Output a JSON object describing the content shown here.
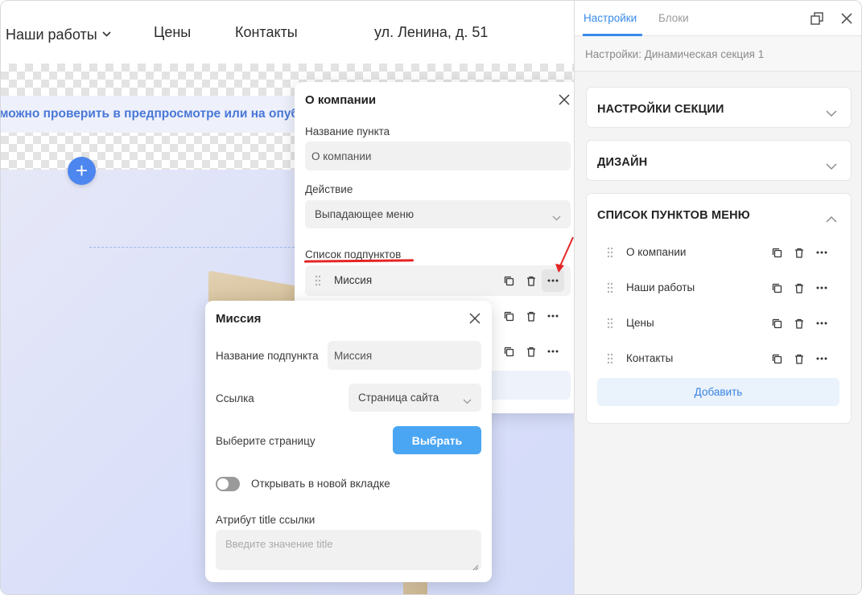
{
  "site_nav": {
    "items": [
      {
        "label": "Наши работы"
      },
      {
        "label": "Цены"
      },
      {
        "label": "Контакты"
      },
      {
        "label": "ул. Ленина, д. 51"
      }
    ]
  },
  "canvas": {
    "notice_text": "можно проверить в предпросмотре или на опуб",
    "add_icon": "plus-icon"
  },
  "popup_item": {
    "title": "О компании",
    "name_label": "Название пункта",
    "name_value": "О компании",
    "action_label": "Действие",
    "action_value": "Выпадающее меню",
    "subitems_label": "Список подпунктов",
    "subitems": [
      {
        "label": "Миссия"
      },
      {
        "label": ""
      },
      {
        "label": ""
      }
    ]
  },
  "popup_subitem": {
    "title": "Миссия",
    "name_label": "Название подпункта",
    "name_value": "Миссия",
    "link_label": "Ссылка",
    "link_value": "Страница сайта",
    "page_label": "Выберите страницу",
    "choose_button": "Выбрать",
    "new_tab_label": "Открывать в новой вкладке",
    "new_tab_on": false,
    "title_attr_label": "Атрибут title ссылки",
    "title_attr_placeholder": "Введите значение title"
  },
  "panel": {
    "tabs": [
      {
        "label": "Настройки",
        "active": true
      },
      {
        "label": "Блоки",
        "active": false
      }
    ],
    "breadcrumb": "Настройки: Динамическая секция 1",
    "sections": {
      "section_settings": "НАСТРОЙКИ СЕКЦИИ",
      "design": "ДИЗАЙН",
      "menu_list": "СПИСОК ПУНКТОВ МЕНЮ"
    },
    "menu_items": [
      {
        "label": "О компании"
      },
      {
        "label": "Наши работы"
      },
      {
        "label": "Цены"
      },
      {
        "label": "Контакты"
      }
    ],
    "add_button": "Добавить"
  },
  "colors": {
    "accent": "#3a8bea",
    "primary_button": "#4aa6f3",
    "highlight_underline": "#e42525",
    "hero_background": "#d8defa"
  }
}
